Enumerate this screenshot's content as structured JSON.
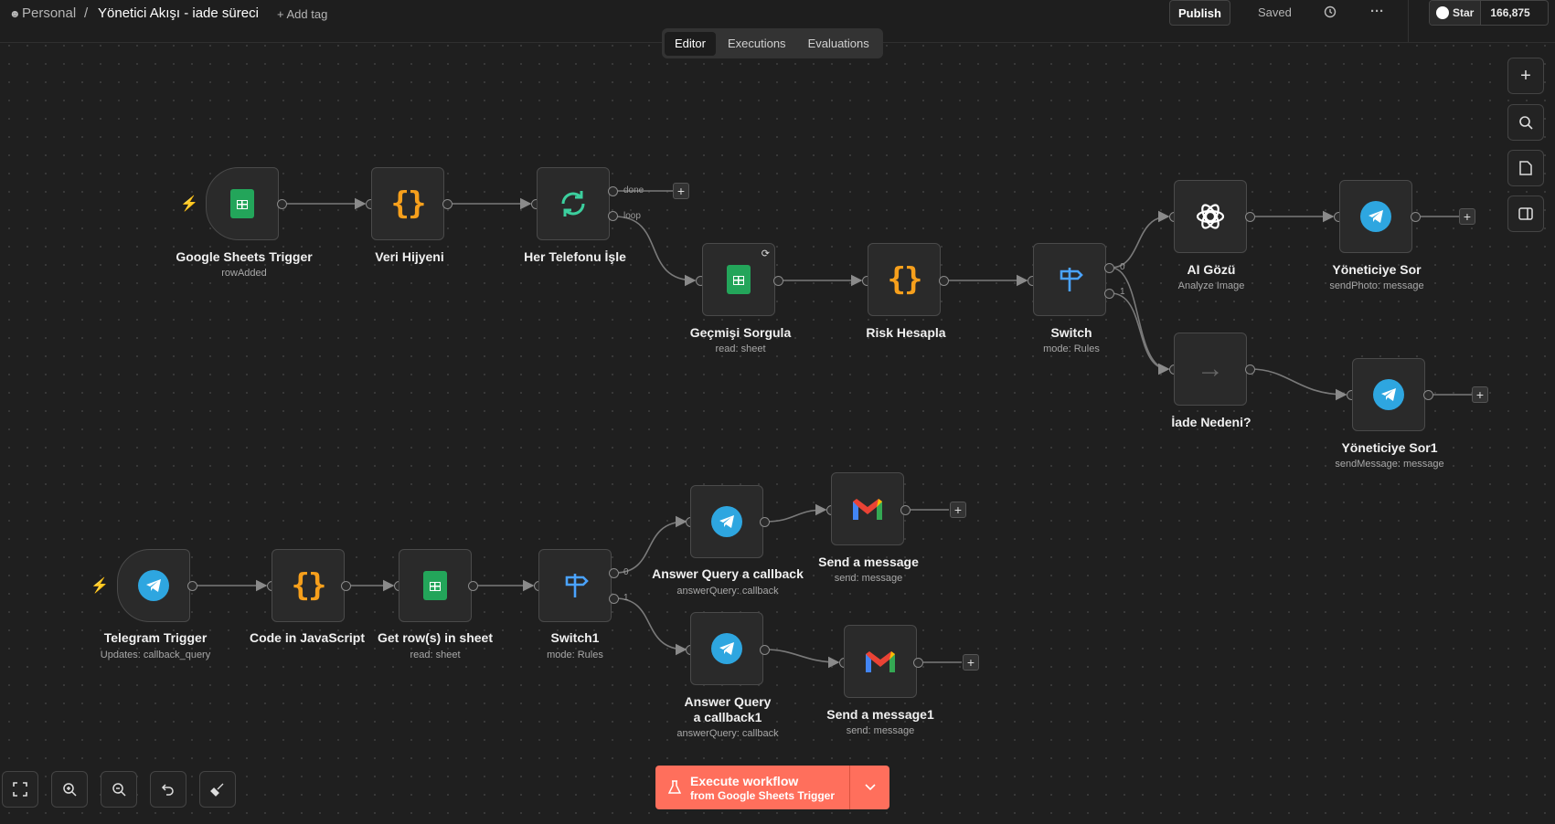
{
  "header": {
    "breadcrumb_project": "Personal",
    "breadcrumb_sep": "/",
    "workflow_name": "Yönetici Akışı - iade süreci",
    "add_tag": "+ Add tag",
    "publish": "Publish",
    "saved": "Saved",
    "more": "···",
    "github_star": "Star",
    "github_count": "166,875"
  },
  "tabs": [
    "Editor",
    "Executions",
    "Evaluations"
  ],
  "nodes": {
    "sheets_trigger": {
      "name": "Google Sheets Trigger",
      "sub": "rowAdded"
    },
    "veri": {
      "name": "Veri Hijyeni"
    },
    "loop": {
      "name": "Her Telefonu İşle",
      "done": "done",
      "loop": "loop"
    },
    "gecmisi": {
      "name": "Geçmişi Sorgula",
      "sub": "read: sheet"
    },
    "risk": {
      "name": "Risk Hesapla"
    },
    "switch": {
      "name": "Switch",
      "sub": "mode: Rules",
      "out0": "0",
      "out1": "1"
    },
    "ai": {
      "name": "AI Gözü",
      "sub": "Analyze Image"
    },
    "yon": {
      "name": "Yöneticiye Sor",
      "sub": "sendPhoto: message"
    },
    "iade": {
      "name": "İade Nedeni?"
    },
    "yon1": {
      "name": "Yöneticiye Sor1",
      "sub": "sendMessage: message"
    },
    "tg_trigger": {
      "name": "Telegram Trigger",
      "sub": "Updates: callback_query"
    },
    "code": {
      "name": "Code in JavaScript"
    },
    "getrows": {
      "name": "Get row(s) in sheet",
      "sub": "read: sheet"
    },
    "switch1": {
      "name": "Switch1",
      "sub": "mode: Rules",
      "out0": "0",
      "out1": "1"
    },
    "answer": {
      "name": "Answer Query a callback",
      "sub": "answerQuery: callback"
    },
    "answer1": {
      "name": "Answer Query a callback1",
      "sub": "answerQuery: callback"
    },
    "send": {
      "name": "Send a message",
      "sub": "send: message"
    },
    "send1": {
      "name": "Send a message1",
      "sub": "send: message"
    }
  },
  "plus_symbol": "+",
  "execute": {
    "title": "Execute workflow",
    "subtitle": "from Google Sheets Trigger"
  },
  "colors": {
    "accent": "#ff6f5c",
    "sheets": "#23a55a",
    "telegram": "#2ea6e0",
    "code": "#f7a01c",
    "switch": "#4aa3ff",
    "loop": "#3ccf9e"
  }
}
